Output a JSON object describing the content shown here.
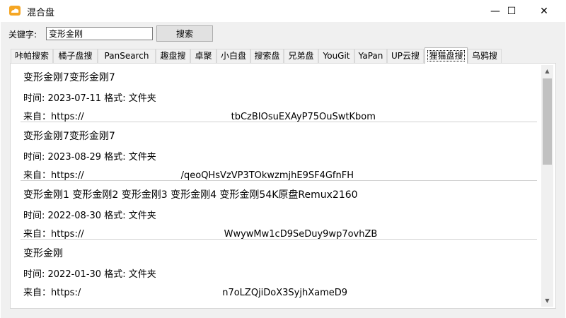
{
  "window": {
    "title": "混合盘",
    "icon": "cloud-icon",
    "minimize_glyph": "—",
    "maximize_glyph": "☐",
    "close_glyph": "✕"
  },
  "search": {
    "label": "关键字:",
    "value": "变形金刚",
    "button_label": "搜索"
  },
  "tabs": [
    {
      "label": "咔帕搜索"
    },
    {
      "label": "橘子盘搜"
    },
    {
      "label": "PanSearch"
    },
    {
      "label": "趣盘搜"
    },
    {
      "label": "卓聚"
    },
    {
      "label": "小白盘"
    },
    {
      "label": "搜索盘"
    },
    {
      "label": "兄弟盘"
    },
    {
      "label": "YouGit"
    },
    {
      "label": "YaPan"
    },
    {
      "label": "UP云搜"
    },
    {
      "label": "狸猫盘搜"
    },
    {
      "label": "乌鸦搜"
    }
  ],
  "active_tab": "狸猫盘搜",
  "results": [
    {
      "title": "变形金刚7变形金刚7",
      "meta": "时间: 2023-07-11 格式: 文件夹",
      "source_prefix": "来自：https://",
      "source_suffix": "tbCzBIOsuEXAyP75OuSwtKbom"
    },
    {
      "title": "变形金刚7变形金刚7",
      "meta": "时间: 2023-08-29 格式: 文件夹",
      "source_prefix": "来自：https://",
      "source_suffix": "/qeoQHsVzVP3TOkwzmjhE9SF4GfnFH"
    },
    {
      "title": "变形金刚1 变形金刚2 变形金刚3 变形金刚4 变形金刚54K原盘Remux2160",
      "meta": "时间: 2022-08-30 格式: 文件夹",
      "source_prefix": "来自：https://",
      "source_suffix": "WwywMw1cD9SeDuy9wp7ovhZB"
    },
    {
      "title": "变形金刚",
      "meta": "时间: 2022-01-30 格式: 文件夹",
      "source_prefix": "来自：https:/",
      "source_suffix": "n7oLZQjiDoX3SyjhXameD9"
    }
  ],
  "scrollbar": {
    "up_glyph": "▲",
    "down_glyph": "▼"
  },
  "colors": {
    "panel_bg": "#ffffff",
    "client_bg": "#f0f0f0",
    "icon_orange": "#f5a623"
  }
}
